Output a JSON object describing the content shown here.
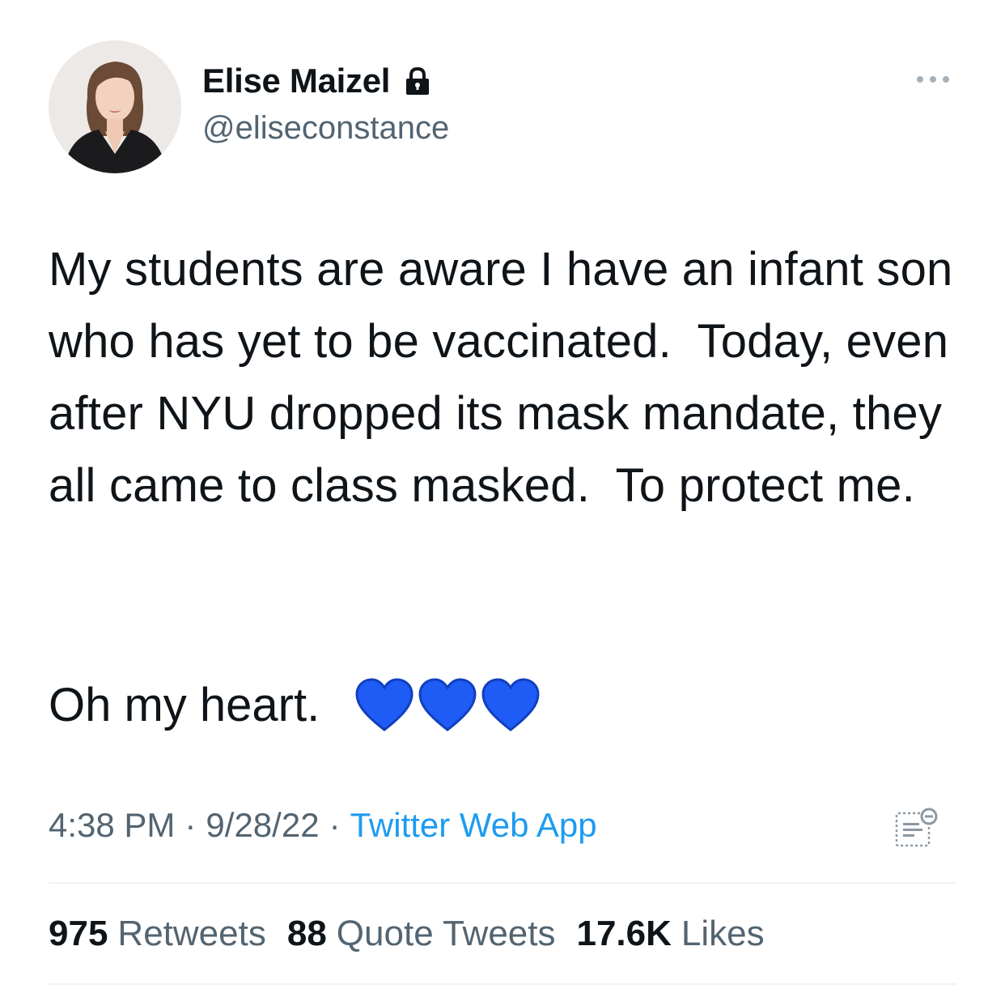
{
  "author": {
    "display_name": "Elise Maizel",
    "handle": "@eliseconstance",
    "protected_icon": "lock-icon",
    "avatar_icon": "avatar-photo"
  },
  "tweet": {
    "text": "My students are aware I have an infant son who has yet to be vaccinated.  Today, even after NYU dropped its mask mandate, they all came to class masked.  To protect me.",
    "text2": "Oh my heart.",
    "emoji_icon": "blue-heart-icon",
    "emoji_count": 3
  },
  "meta": {
    "time": "4:38 PM",
    "date": "9/28/22",
    "separator": "·",
    "source": "Twitter Web App"
  },
  "stats": {
    "retweets_count": "975",
    "retweets_label": "Retweets",
    "quotes_count": "88",
    "quotes_label": "Quote Tweets",
    "likes_count": "17.6K",
    "likes_label": "Likes"
  },
  "colors": {
    "text": "#0f1419",
    "secondary": "#536471",
    "link": "#1d9bf0",
    "heart": "#1f5cf5",
    "divider": "#eff3f4"
  }
}
